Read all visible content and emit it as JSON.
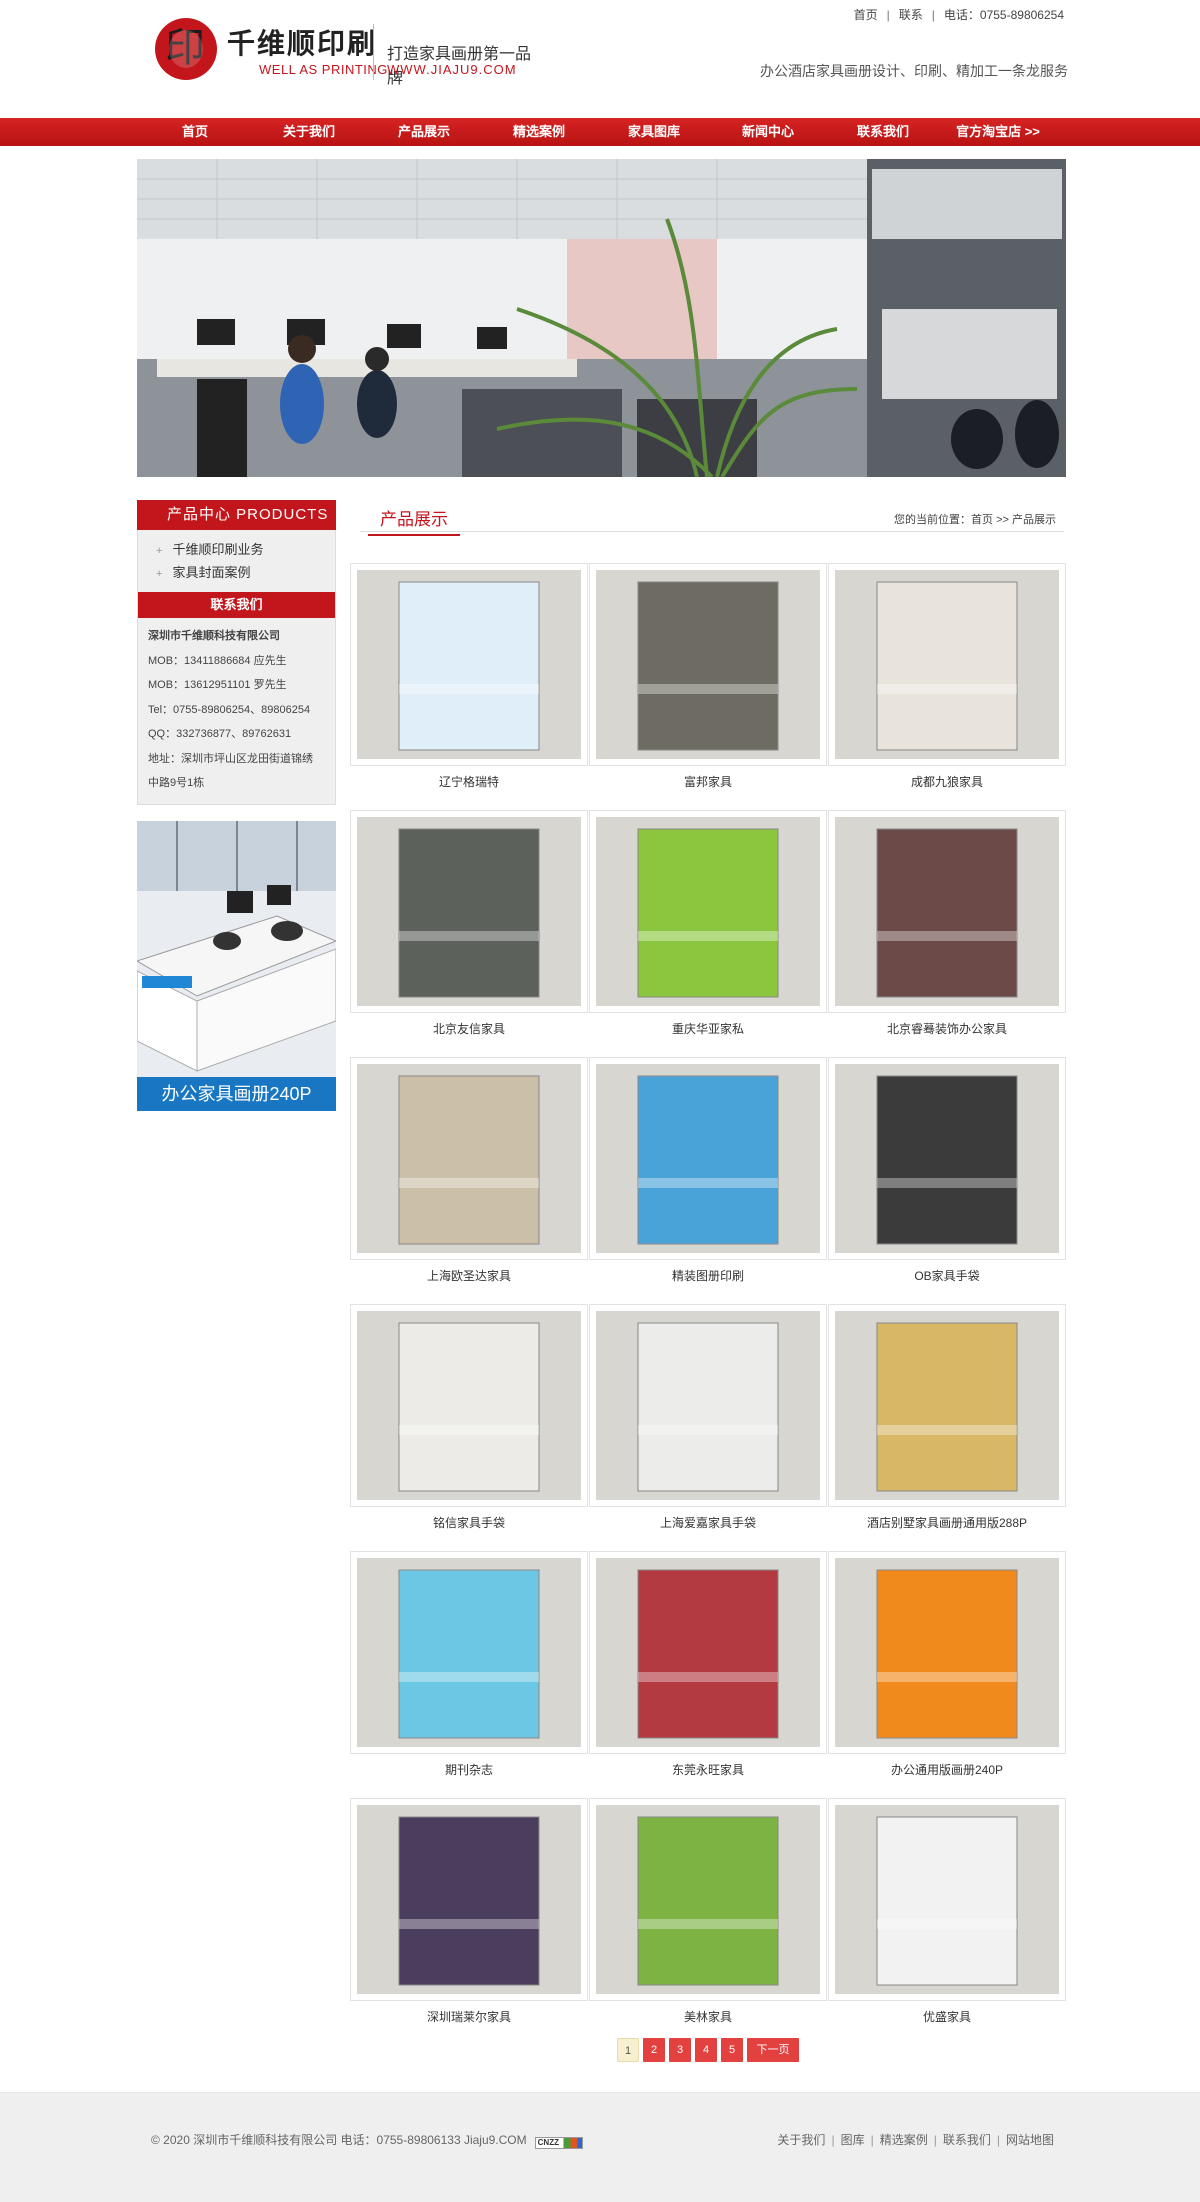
{
  "header": {
    "logo_char": "印",
    "logo_cn": "千维顺印刷",
    "logo_en": "WELL AS PRINTING",
    "slogan": "打造家具画册第一品牌",
    "site_url": "WWW.JIAJU9.COM",
    "top_links": [
      "首页",
      "联系",
      "电话：0755-89806254"
    ],
    "service": "办公酒店家具画册设计、印刷、精加工一条龙服务"
  },
  "nav": {
    "items": [
      "首页",
      "关于我们",
      "产品展示",
      "精选案例",
      "家具图库",
      "新闻中心",
      "联系我们",
      "官方淘宝店 >>"
    ]
  },
  "sidebar": {
    "products_title": "产品中心 PRODUCTS",
    "categories": [
      "千维顺印刷业务",
      "家具封面案例"
    ],
    "contact_title": "联系我们",
    "contact_lines": [
      "深圳市千维顺科技有限公司",
      "MOB：13411886684 应先生",
      "MOB：13612951101 罗先生",
      "Tel：0755-89806254、89806254",
      "QQ：332736877、89762631",
      "地址：深圳市坪山区龙田街道锦绣",
      "中路9号1栋"
    ],
    "ad_label": "办公家具画册240P"
  },
  "main": {
    "title": "产品展示",
    "breadcrumb": "您的当前位置：首页 >> 产品展示",
    "products": [
      {
        "name": "辽宁格瑞特",
        "color": "#dfeef8"
      },
      {
        "name": "富邦家具",
        "color": "#6e6c62"
      },
      {
        "name": "成都九狼家具",
        "color": "#e8e4dc"
      },
      {
        "name": "北京友信家具",
        "color": "#5c615c"
      },
      {
        "name": "重庆华亚家私",
        "color": "#8cc63f"
      },
      {
        "name": "北京睿蓦装饰办公家具",
        "color": "#6b4a47"
      },
      {
        "name": "上海欧圣达家具",
        "color": "#cbbfa8"
      },
      {
        "name": "精装图册印刷",
        "color": "#4aa3d8"
      },
      {
        "name": "OB家具手袋",
        "color": "#3b3b3b"
      },
      {
        "name": "铭信家具手袋",
        "color": "#ecebe7"
      },
      {
        "name": "上海爱嘉家具手袋",
        "color": "#ececea"
      },
      {
        "name": "酒店别墅家具画册通用版288P",
        "color": "#d8b766"
      },
      {
        "name": "期刊杂志",
        "color": "#6cc7e4"
      },
      {
        "name": "东莞永旺家具",
        "color": "#b23a40"
      },
      {
        "name": "办公通用版画册240P",
        "color": "#f08a1c"
      },
      {
        "name": "深圳瑞莱尔家具",
        "color": "#4a3d5e"
      },
      {
        "name": "美林家具",
        "color": "#7cb342"
      },
      {
        "name": "优盛家具",
        "color": "#f2f2f2"
      }
    ]
  },
  "pager": {
    "pages": [
      "1",
      "2",
      "3",
      "4",
      "5"
    ],
    "next": "下一页"
  },
  "footer": {
    "copyright": "© 2020 深圳市千维顺科技有限公司 电话：0755-89806133 Jiaju9.COM",
    "cnzz": "CNZZ",
    "links": [
      "关于我们",
      "图库",
      "精选案例",
      "联系我们",
      "网站地图"
    ]
  }
}
